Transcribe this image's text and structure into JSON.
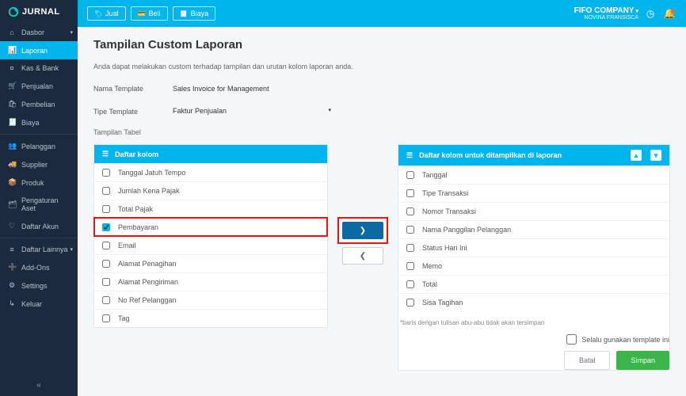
{
  "brand": "JURNAL",
  "sidebar": {
    "items": [
      {
        "icon": "⌂",
        "label": "Dasbor",
        "chev": true
      },
      {
        "icon": "📊",
        "label": "Laporan",
        "active": true
      },
      {
        "icon": "¤",
        "label": "Kas & Bank"
      },
      {
        "icon": "🛒",
        "label": "Penjualan"
      },
      {
        "icon": "🛍",
        "label": "Pembelian"
      },
      {
        "icon": "🧾",
        "label": "Biaya"
      }
    ],
    "items2": [
      {
        "icon": "👥",
        "label": "Pelanggan"
      },
      {
        "icon": "🚚",
        "label": "Supplier"
      },
      {
        "icon": "📦",
        "label": "Produk"
      },
      {
        "icon": "🗂",
        "label": "Pengaturan Aset"
      },
      {
        "icon": "♡",
        "label": "Daftar Akun"
      }
    ],
    "items3": [
      {
        "icon": "≡",
        "label": "Daftar Lainnya",
        "chev": true
      },
      {
        "icon": "➕",
        "label": "Add-Ons"
      },
      {
        "icon": "⚙",
        "label": "Settings"
      },
      {
        "icon": "↳",
        "label": "Keluar"
      }
    ]
  },
  "topbar": {
    "buttons": [
      {
        "icon": "🏷",
        "label": "Jual"
      },
      {
        "icon": "💳",
        "label": "Beli"
      },
      {
        "icon": "🧾",
        "label": "Biaya"
      }
    ],
    "company": "FIFO COMPANY",
    "user": "NOVINA FRANSISCA"
  },
  "page": {
    "title": "Tampilan Custom Laporan",
    "desc": "Anda dapat melakukan custom terhadap tampilan dan urutan kolom laporan anda.",
    "form": {
      "nama_label": "Nama Template",
      "nama_value": "Sales Invoice for Management",
      "tipe_label": "Tipe Template",
      "tipe_value": "Faktur Penjualan"
    },
    "subhead": "Tampilan Tabel",
    "left_panel": {
      "title": "Daftar kolom",
      "rows": [
        {
          "label": "Tanggal Jatuh Tempo",
          "checked": false
        },
        {
          "label": "Jumlah Kena Pajak",
          "checked": false
        },
        {
          "label": "Total Pajak",
          "checked": false
        },
        {
          "label": "Pembayaran",
          "checked": true,
          "hl": true
        },
        {
          "label": "Email",
          "checked": false
        },
        {
          "label": "Alamat Penagihan",
          "checked": false
        },
        {
          "label": "Alamat Pengiriman",
          "checked": false
        },
        {
          "label": "No Ref Pelanggan",
          "checked": false
        },
        {
          "label": "Tag",
          "checked": false
        }
      ]
    },
    "right_panel": {
      "title": "Daftar kolom untuk ditampilkan di laporan",
      "rows": [
        {
          "label": "Tanggal"
        },
        {
          "label": "Tipe Transaksi"
        },
        {
          "label": "Nomor Transaksi"
        },
        {
          "label": "Nama Panggilan Pelanggan"
        },
        {
          "label": "Status Hari Ini"
        },
        {
          "label": "Memo"
        },
        {
          "label": "Total"
        },
        {
          "label": "Sisa Tagihan"
        }
      ]
    },
    "note": "*baris dengan tulisan abu-abu tidak akan tersimpan",
    "always_label": "Selalu gunakan template ini",
    "cancel": "Batal",
    "save": "Simpan"
  }
}
